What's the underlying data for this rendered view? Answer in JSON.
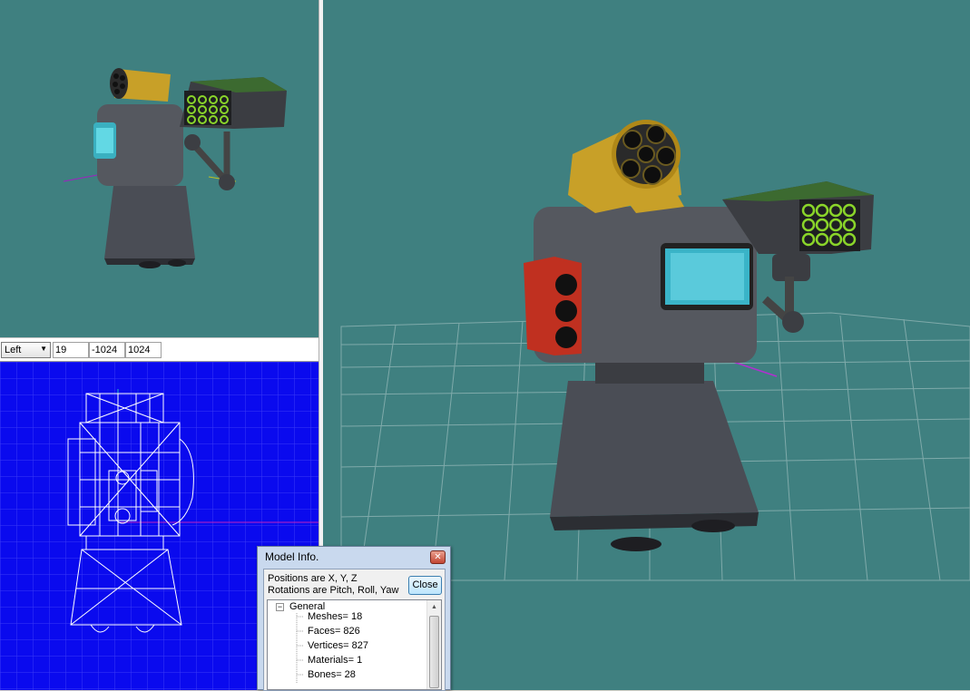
{
  "ortho_toolbar": {
    "view_select": "Left",
    "fields": [
      "19",
      "-1024",
      "1024"
    ]
  },
  "model_info": {
    "title": "Model Info.",
    "line1": "Positions are X, Y, Z",
    "line2": "Rotations are Pitch, Roll, Yaw",
    "close_label": "Close",
    "tree": {
      "root": "General",
      "items": [
        "Meshes= 18",
        "Faces= 826",
        "Vertices= 827",
        "Materials= 1",
        "Bones= 28"
      ]
    }
  },
  "colors": {
    "viewport_bg": "#3f8080",
    "ortho_bg": "#0a0aee"
  }
}
